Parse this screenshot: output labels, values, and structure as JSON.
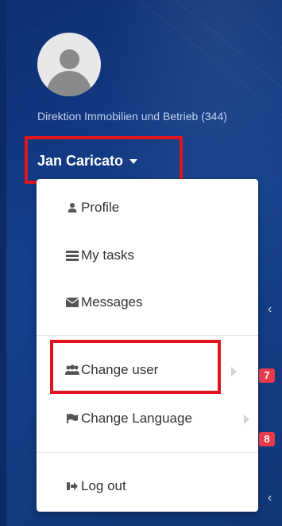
{
  "sidebar": {
    "organization": "Direktion Immobilien und Betrieb (344)",
    "user_name": "Jan Caricato"
  },
  "menu": {
    "items": [
      {
        "label": "Profile",
        "icon": "user-icon"
      },
      {
        "label": "My tasks",
        "icon": "tasks-icon"
      },
      {
        "label": "Messages",
        "icon": "envelope-icon"
      },
      {
        "label": "Change user",
        "icon": "users-icon"
      },
      {
        "label": "Change Language",
        "icon": "flag-icon"
      },
      {
        "label": "Log out",
        "icon": "logout-icon"
      }
    ]
  },
  "badges": {
    "first": "7",
    "second": "8"
  },
  "colors": {
    "background": "#123a7d",
    "highlight": "#e1141f",
    "badge": "#e83a4a"
  }
}
